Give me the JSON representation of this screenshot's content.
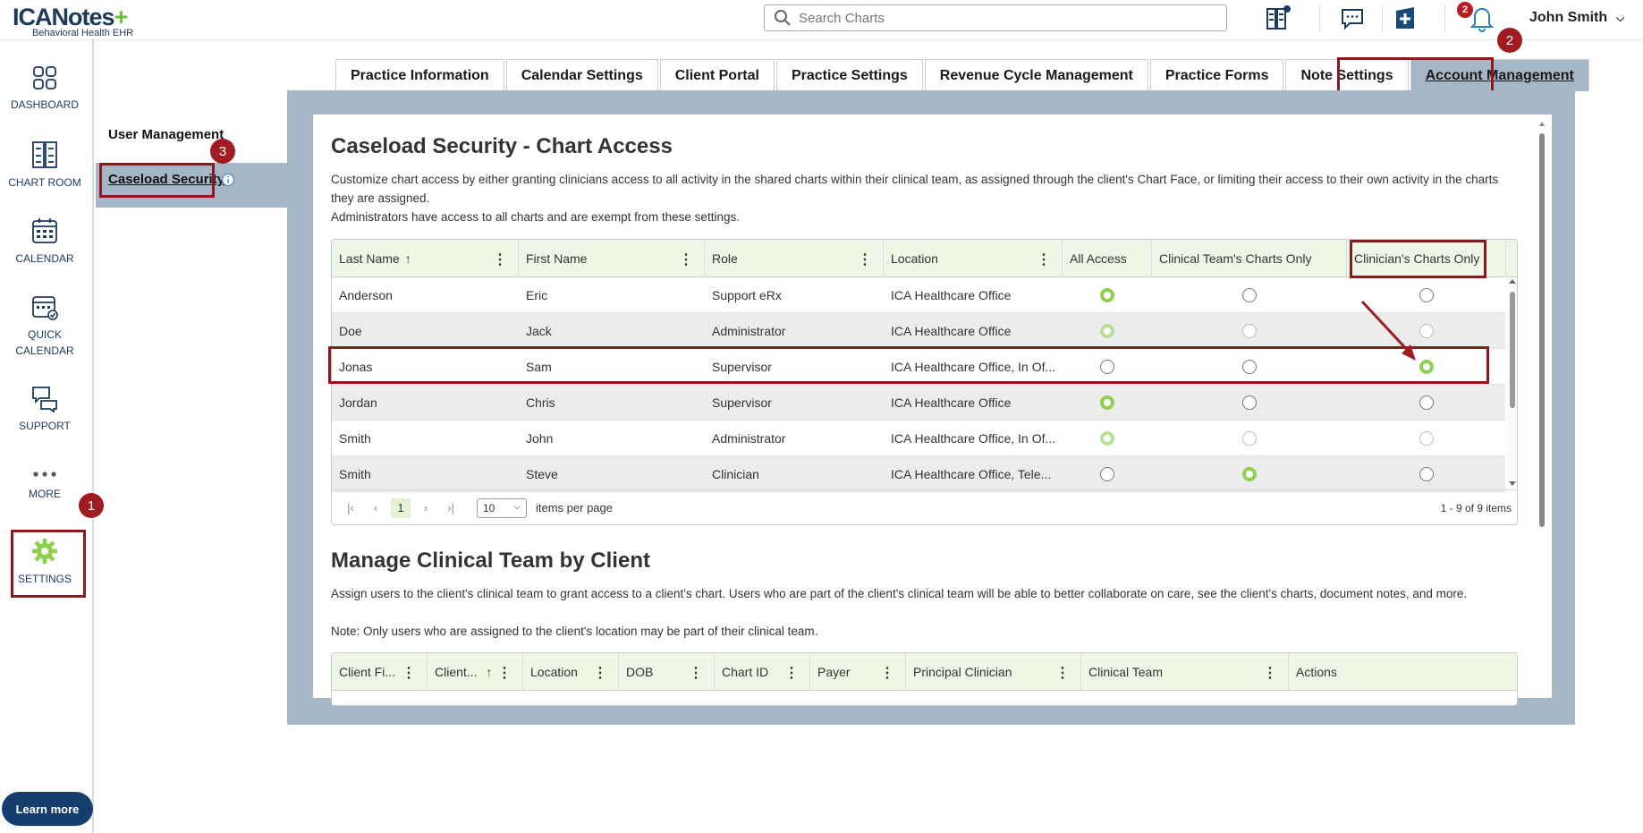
{
  "header": {
    "logo_main": "ICANotes",
    "logo_sub": "Behavioral Health EHR",
    "search_placeholder": "Search Charts",
    "notification_count": "2",
    "user_name": "John Smith"
  },
  "leftnav": {
    "items": [
      {
        "label": "DASHBOARD"
      },
      {
        "label": "CHART ROOM"
      },
      {
        "label": "CALENDAR"
      },
      {
        "label": "QUICK\nCALENDAR"
      },
      {
        "label": "SUPPORT"
      },
      {
        "label": "MORE"
      },
      {
        "label": "SETTINGS"
      }
    ],
    "learn_more": "Learn more"
  },
  "steps": [
    "1",
    "2",
    "3"
  ],
  "subnav": {
    "user_management": "User Management",
    "caseload_security": "Caseload Security"
  },
  "tabs": [
    {
      "label": "Practice Information"
    },
    {
      "label": "Calendar Settings"
    },
    {
      "label": "Client Portal"
    },
    {
      "label": "Practice Settings"
    },
    {
      "label": "Revenue Cycle Management"
    },
    {
      "label": "Practice Forms"
    },
    {
      "label": "Note Settings"
    },
    {
      "label": "Account Management"
    }
  ],
  "caseload": {
    "title": "Caseload Security - Chart Access",
    "desc1": "Customize chart access by either granting clinicians access to all activity in the shared charts within their clinical team, as assigned through the client's Chart Face, or limiting their access to their own activity in the charts they are assigned.",
    "desc2": "Administrators have access to all charts and are exempt from these settings.",
    "columns": {
      "last_name": "Last Name",
      "first_name": "First Name",
      "role": "Role",
      "location": "Location",
      "all_access": "All Access",
      "team_only": "Clinical Team's Charts Only",
      "clinician_only": "Clinician's Charts Only"
    },
    "rows": [
      {
        "last": "Anderson",
        "first": "Eric",
        "role": "Support eRx",
        "location": "ICA Healthcare Office",
        "selected": "all",
        "disabled": false
      },
      {
        "last": "Doe",
        "first": "Jack",
        "role": "Administrator",
        "location": "ICA Healthcare Office",
        "selected": "all",
        "disabled": true
      },
      {
        "last": "Jonas",
        "first": "Sam",
        "role": "Supervisor",
        "location": "ICA Healthcare Office, In Of...",
        "selected": "clinician",
        "disabled": false
      },
      {
        "last": "Jordan",
        "first": "Chris",
        "role": "Supervisor",
        "location": "ICA Healthcare Office",
        "selected": "all",
        "disabled": false
      },
      {
        "last": "Smith",
        "first": "John",
        "role": "Administrator",
        "location": "ICA Healthcare Office, In Of...",
        "selected": "all",
        "disabled": true
      },
      {
        "last": "Smith",
        "first": "Steve",
        "role": "Clinician",
        "location": "ICA Healthcare Office, Tele...",
        "selected": "team",
        "disabled": false
      }
    ],
    "pager": {
      "page": "1",
      "page_size": "10",
      "items_per_page": "items per page",
      "info": "1 - 9 of 9 items"
    }
  },
  "clinical_team": {
    "title": "Manage Clinical Team by Client",
    "desc1": "Assign users to the client's clinical team to grant access to a client's chart. Users who are part of the client's clinical team will be able to better collaborate on care, see the client's charts, document notes, and more.",
    "desc2": "Note: Only users who are assigned to the client's location may be part of their clinical team.",
    "columns": [
      "Client Fi...",
      "Client...",
      "Location",
      "DOB",
      "Chart ID",
      "Payer",
      "Principal Clinician",
      "Clinical Team",
      "Actions"
    ]
  },
  "colors": {
    "accent_green": "#8fd14f",
    "frame": "#a5b7c6",
    "annotation": "#8b1a1f",
    "navy": "#153e6e"
  }
}
